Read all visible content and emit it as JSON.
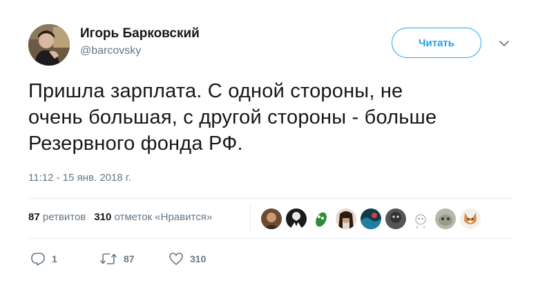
{
  "author": {
    "name": "Игорь Барковский",
    "handle": "@barcovsky"
  },
  "follow_button": {
    "label": "Читать"
  },
  "tweet": {
    "lines": [
      "Пришла зарплата. С одной стороны, не",
      "очень большая, с другой стороны - больше",
      "Резервного фонда РФ."
    ],
    "timestamp": "11:12 - 15 янв. 2018 г."
  },
  "stats": {
    "retweets_count": "87",
    "retweets_label": "ретвитов",
    "likes_count": "310",
    "likes_label": "отметок «Нравится»"
  },
  "likers": [
    {
      "name": "liker-1",
      "color": "#6b4a2f"
    },
    {
      "name": "liker-2",
      "color": "#1a1a1a"
    },
    {
      "name": "liker-3",
      "color": "#2e8b3a"
    },
    {
      "name": "liker-4",
      "color": "#c9a08a"
    },
    {
      "name": "liker-5",
      "color": "#1e7fa0"
    },
    {
      "name": "liker-6",
      "color": "#555555"
    },
    {
      "name": "liker-7",
      "color": "#f0f0f0"
    },
    {
      "name": "liker-8",
      "color": "#9a9a8a"
    },
    {
      "name": "liker-9",
      "color": "#d98a4a"
    }
  ],
  "actions": {
    "reply_count": "1",
    "retweet_count": "87",
    "like_count": "310"
  },
  "colors": {
    "accent": "#1da1f2",
    "muted": "#657786",
    "text": "#14171a",
    "divider": "#e6ecf0"
  }
}
